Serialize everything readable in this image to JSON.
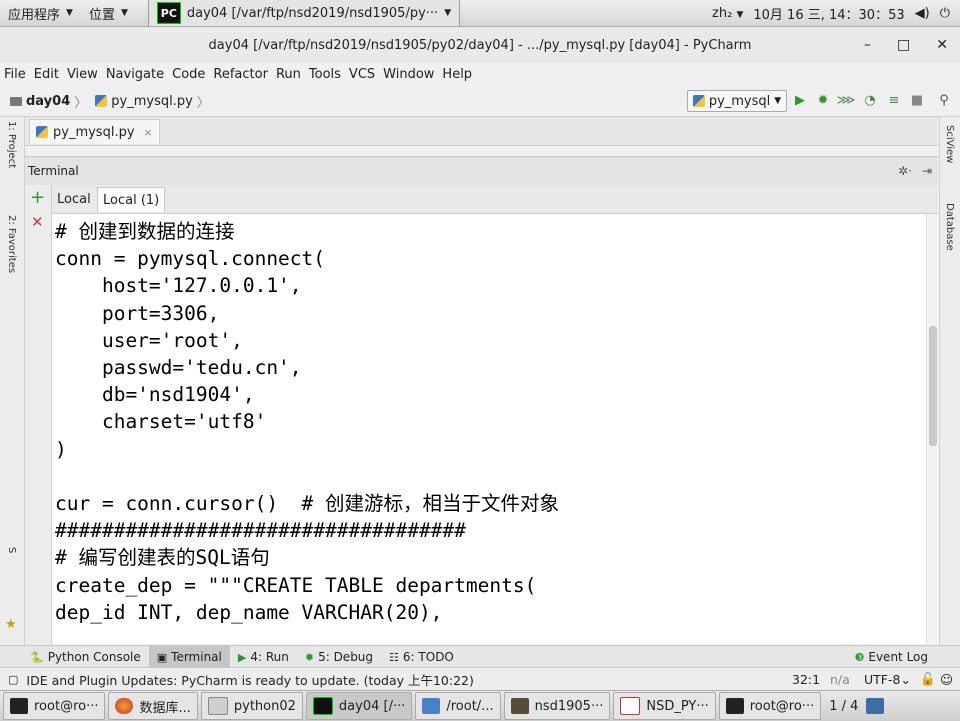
{
  "top_panel": {
    "applications": "应用程序",
    "places": "位置",
    "app_logo": "PC",
    "active_app": "day04 [/var/ftp/nsd2019/nsd1905/py···",
    "input_method": "zh₂",
    "datetime": "10月 16 三, 14：30：53"
  },
  "window": {
    "title": "day04 [/var/ftp/nsd2019/nsd1905/py02/day04] - .../py_mysql.py [day04] - PyCharm",
    "minimize": "–",
    "maximize": "□",
    "close": "✕"
  },
  "menu": [
    "File",
    "Edit",
    "View",
    "Navigate",
    "Code",
    "Refactor",
    "Run",
    "Tools",
    "VCS",
    "Window",
    "Help"
  ],
  "breadcrumb": {
    "project": "day04",
    "file": "py_mysql.py"
  },
  "run_config": {
    "label": "py_mysql"
  },
  "left_strip": {
    "top_label": "1: Project",
    "bottom_label": "2: Favorites"
  },
  "right_strip": {
    "top_label": "SciView",
    "bottom_label": "Database"
  },
  "editor_tab": {
    "label": "py_mysql.py"
  },
  "terminal": {
    "title": "Terminal",
    "tabs": [
      "Local",
      "Local (1)"
    ],
    "lines": [
      "# 创建到数据的连接",
      "conn = pymysql.connect(",
      "    host='127.0.0.1',",
      "    port=3306,",
      "    user='root',",
      "    passwd='tedu.cn',",
      "    db='nsd1904',",
      "    charset='utf8'",
      ")",
      "",
      "cur = conn.cursor()  # 创建游标，相当于文件对象",
      "###################################",
      "# 编写创建表的SQL语句",
      "create_dep = \"\"\"CREATE TABLE departments(",
      "dep_id INT, dep_name VARCHAR(20),"
    ]
  },
  "tool_windows": {
    "python_console": "Python Console",
    "terminal": "Terminal",
    "run": "4: Run",
    "debug": "5: Debug",
    "todo": "6: TODO",
    "event_log": "Event Log"
  },
  "status": {
    "message": "IDE and Plugin Updates: PyCharm is ready to update. (today 上午10:22)",
    "position": "32:1",
    "line_sep": "n/a",
    "encoding": "UTF-8"
  },
  "taskbar": {
    "tasks": [
      "root@ro···",
      "数据库...",
      "python02",
      "day04 [/···",
      "/root/...",
      "nsd1905···",
      "NSD_PY···",
      "root@ro···"
    ],
    "pager": "1 / 4"
  }
}
